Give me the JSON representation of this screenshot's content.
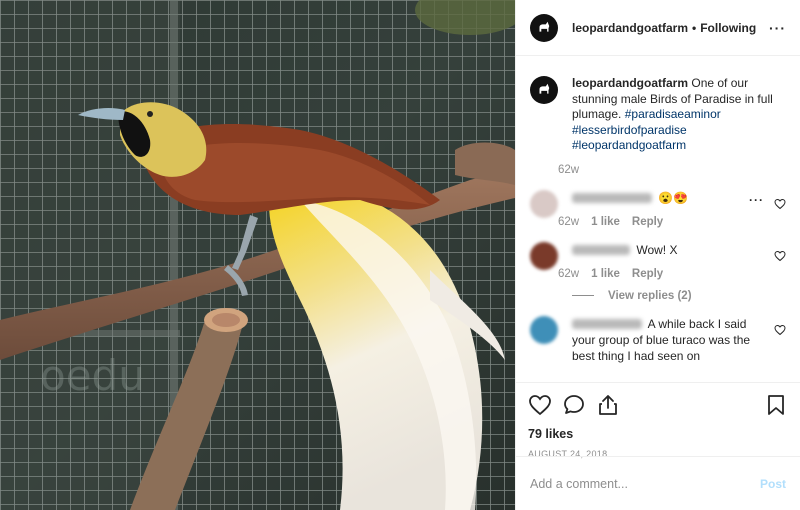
{
  "post": {
    "username": "leopardandgoatfarm",
    "separator": "•",
    "follow_status": "Following",
    "more_label": "···"
  },
  "caption": {
    "username": "leopardandgoatfarm",
    "text": "One of our stunning male Birds of Paradise in full plumage.",
    "hashtags": [
      "#paradisaeaminor",
      "#lesserbirdofparadise",
      "#leopardandgoatfarm"
    ],
    "age": "62w"
  },
  "comments": [
    {
      "text": "😮😍",
      "age": "62w",
      "likes": "1 like",
      "reply": "Reply",
      "avatar_color": "#d9c9c6"
    },
    {
      "text": "Wow! X",
      "age": "62w",
      "likes": "1 like",
      "reply": "Reply",
      "avatar_color": "#7a3a2a",
      "view_replies": "View replies (2)"
    },
    {
      "text": "A while back I said your group of blue turaco was the best thing I had seen on",
      "avatar_color": "#3f8fb8"
    }
  ],
  "actions": {
    "likes": "79 likes",
    "date": "AUGUST 24, 2018",
    "add_comment_placeholder": "Add a comment...",
    "post_label": "Post",
    "icons": [
      "heart-icon",
      "comment-icon",
      "share-icon",
      "bookmark-icon"
    ]
  },
  "photo": {
    "watermark": "oedu"
  },
  "colors": {
    "link": "#003569",
    "muted": "#8e8e8e",
    "post_disabled": "#b2dffc"
  }
}
